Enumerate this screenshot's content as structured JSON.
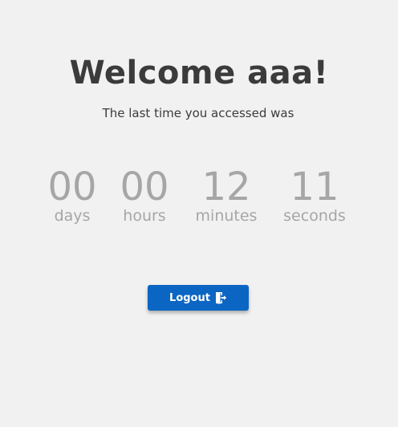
{
  "welcome": {
    "title": "Welcome aaa!",
    "subtitle": "The last time you accessed was"
  },
  "countdown": {
    "days": {
      "value": "00",
      "label": "days"
    },
    "hours": {
      "value": "00",
      "label": "hours"
    },
    "minutes": {
      "value": "12",
      "label": "minutes"
    },
    "seconds": {
      "value": "11",
      "label": "seconds"
    }
  },
  "logout": {
    "label": "Logout",
    "icon": "logout-door-icon"
  },
  "colors": {
    "background": "#f1f1f1",
    "title_text": "#3b3b3b",
    "countdown_text": "#a6a6a6",
    "button_bg": "#0b66c3",
    "button_text": "#ffffff"
  }
}
